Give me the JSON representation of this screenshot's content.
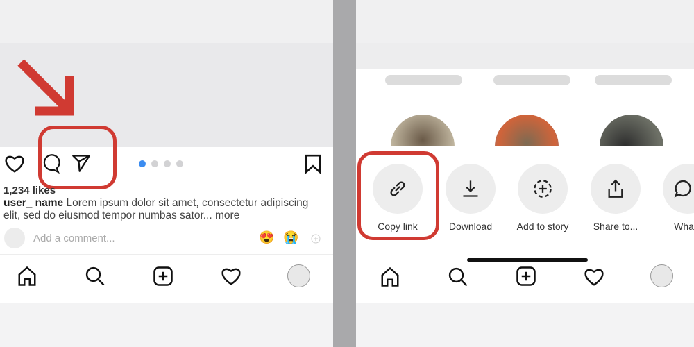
{
  "left": {
    "carousel": {
      "count": 4,
      "active": 1
    },
    "likes": "1,234 likes",
    "username": "user_ name",
    "caption": "Lorem ipsum dolor sit amet, consectetur adipiscing elit, sed do eiusmod tempor numbas sator...",
    "more": "more",
    "comment_placeholder": "Add a comment...",
    "emojis": [
      "😍",
      "😭"
    ],
    "nav": [
      "home-icon",
      "search-icon",
      "add-icon",
      "heart-icon",
      "profile-avatar"
    ]
  },
  "right": {
    "actions": [
      {
        "label": "Copy link",
        "icon": "link-icon"
      },
      {
        "label": "Download",
        "icon": "download-icon"
      },
      {
        "label": "Add to story",
        "icon": "add-story-icon"
      },
      {
        "label": "Share to...",
        "icon": "share-icon"
      },
      {
        "label": "Whats",
        "icon": "whatsapp-icon"
      }
    ]
  },
  "colors": {
    "highlight": "#d03a32",
    "active_dot": "#3b8cf0"
  }
}
